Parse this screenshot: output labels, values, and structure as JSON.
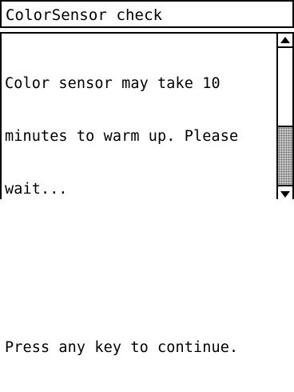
{
  "window": {
    "title": "ColorSensor check"
  },
  "message": {
    "lines": [
      "Color sensor may take 10",
      "minutes to warm up. Please",
      "wait...",
      "",
      "",
      "Press any key to continue."
    ]
  },
  "scrollbar": {
    "up_icon": "arrow-up-icon",
    "down_icon": "arrow-down-icon",
    "thumb_position_fraction": 0.57,
    "thumb_size_fraction": 0.43
  }
}
